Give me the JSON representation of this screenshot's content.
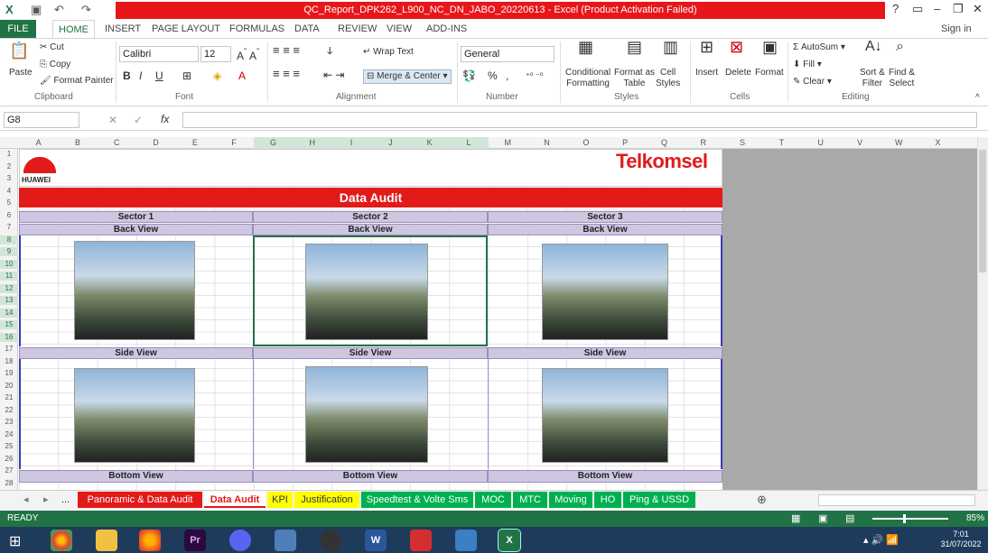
{
  "window": {
    "title": "QC_Report_DPK262_L900_NC_DN_JABO_20220613 -  Excel (Product Activation Failed)",
    "help": "?",
    "signin": "Sign in"
  },
  "ribbon_tabs": [
    "FILE",
    "HOME",
    "INSERT",
    "PAGE LAYOUT",
    "FORMULAS",
    "DATA",
    "REVIEW",
    "VIEW",
    "ADD-INS"
  ],
  "clipboard": {
    "cut": "Cut",
    "copy": "Copy",
    "paste": "Paste",
    "format_painter": "Format Painter",
    "label": "Clipboard"
  },
  "font": {
    "name": "Calibri",
    "size": "12",
    "label": "Font",
    "bold": "B",
    "italic": "I",
    "underline": "U"
  },
  "alignment": {
    "wrap": "Wrap Text",
    "merge": "Merge & Center",
    "label": "Alignment"
  },
  "number": {
    "format": "General",
    "percent": "%",
    "comma": ",",
    "label": "Number"
  },
  "styles": {
    "cond1": "Conditional",
    "cond2": "Formatting",
    "fmt1": "Format as",
    "fmt2": "Table",
    "cell1": "Cell",
    "cell2": "Styles",
    "label": "Styles"
  },
  "cells": {
    "insert": "Insert",
    "delete": "Delete",
    "format": "Format",
    "label": "Cells"
  },
  "editing": {
    "autosum": "AutoSum",
    "fill": "Fill",
    "clear": "Clear",
    "sort1": "Sort &",
    "sort2": "Filter",
    "find1": "Find &",
    "find2": "Select",
    "label": "Editing"
  },
  "formula_bar": {
    "name_box": "G8",
    "fx": "fx",
    "value": ""
  },
  "columns": [
    "A",
    "B",
    "C",
    "D",
    "E",
    "F",
    "G",
    "H",
    "I",
    "J",
    "K",
    "L",
    "M",
    "N",
    "O",
    "P",
    "Q",
    "R",
    "S",
    "T",
    "U",
    "V",
    "W",
    "X"
  ],
  "rows": [
    "1",
    "2",
    "3",
    "4",
    "5",
    "6",
    "7",
    "8",
    "9",
    "10",
    "11",
    "12",
    "13",
    "14",
    "15",
    "16",
    "17",
    "18",
    "19",
    "20",
    "21",
    "22",
    "23",
    "24",
    "25",
    "26",
    "27",
    "28"
  ],
  "sheet": {
    "huawei": "HUAWEI",
    "telkomsel": "Telkomsel",
    "banner": "Data Audit",
    "sectors": [
      "Sector 1",
      "Sector 2",
      "Sector 3"
    ],
    "back_view": "Back View",
    "side_view": "Side View",
    "bottom_view": "Bottom View"
  },
  "sheet_tabs": [
    {
      "label": "Panoramic & Data Audit",
      "bg": "#e21a1a",
      "fg": "#ffffff"
    },
    {
      "label": "Data Audit",
      "bg": "#ffffff",
      "fg": "#e21a1a"
    },
    {
      "label": "KPI",
      "bg": "#ffff00",
      "fg": "#333333"
    },
    {
      "label": "Justification",
      "bg": "#ffff00",
      "fg": "#333333"
    },
    {
      "label": "Speedtest & Volte Sms",
      "bg": "#00b050",
      "fg": "#ffffff"
    },
    {
      "label": "MOC",
      "bg": "#00b050",
      "fg": "#ffffff"
    },
    {
      "label": "MTC",
      "bg": "#00b050",
      "fg": "#ffffff"
    },
    {
      "label": "Moving",
      "bg": "#00b050",
      "fg": "#ffffff"
    },
    {
      "label": "HO",
      "bg": "#00b050",
      "fg": "#ffffff"
    },
    {
      "label": "Ping & USSD",
      "bg": "#00b050",
      "fg": "#ffffff"
    }
  ],
  "sheet_nav": {
    "more": "..."
  },
  "status": {
    "ready": "READY",
    "zoom": "85%"
  },
  "clock": {
    "time": "7:01",
    "date": "31/07/2022"
  }
}
